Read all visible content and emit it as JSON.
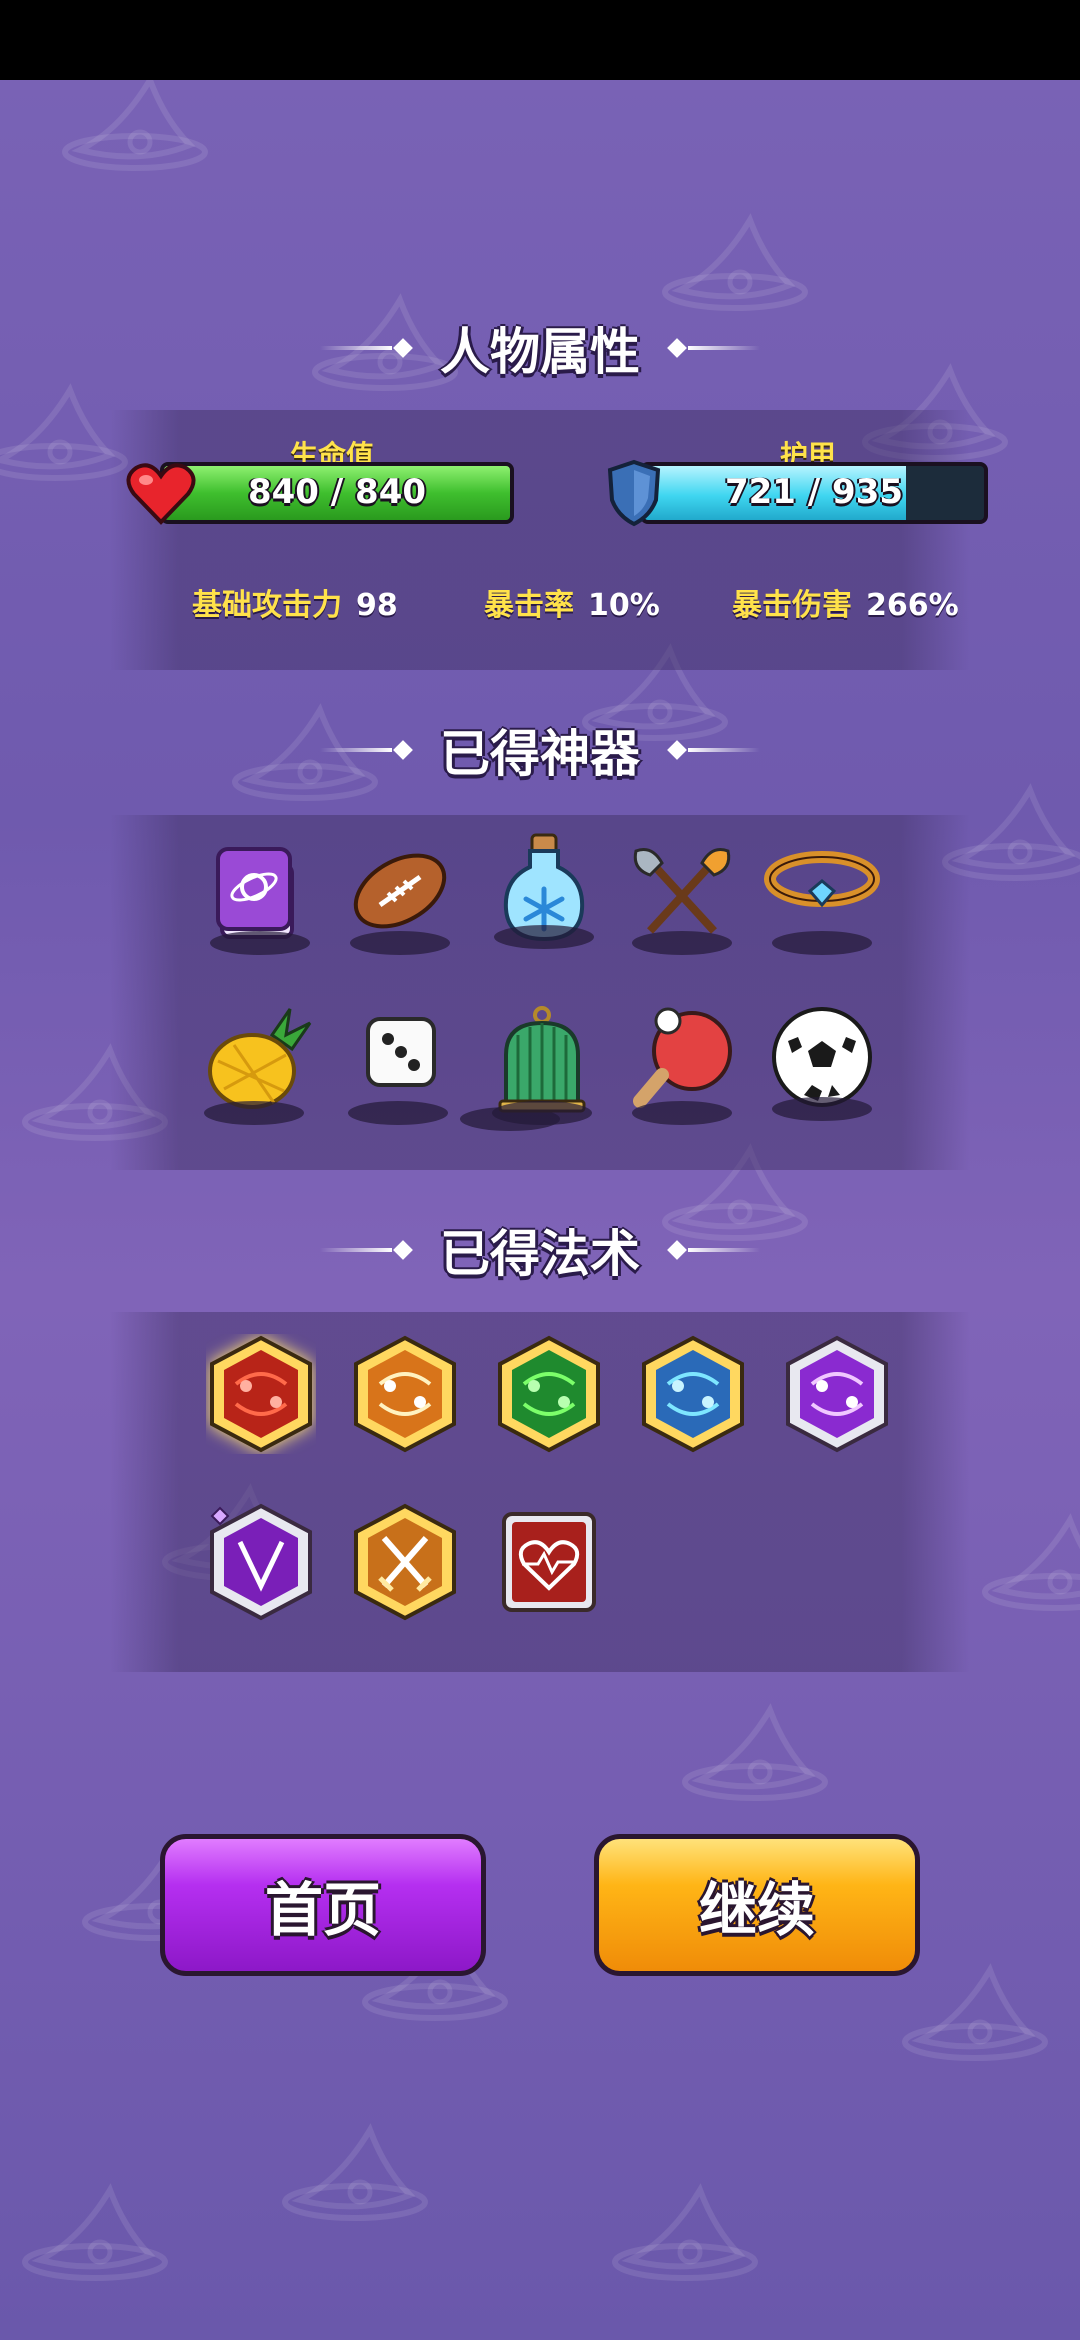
{
  "sections": {
    "attributes_title": "人物属性",
    "artifacts_title": "已得神器",
    "spells_title": "已得法术"
  },
  "hp": {
    "label": "生命值",
    "text": "840 / 840",
    "current": 840,
    "max": 840
  },
  "armor": {
    "label": "护甲",
    "text": "721 / 935",
    "current": 721,
    "max": 935
  },
  "stats": [
    {
      "key": "基础攻击力",
      "value": "98"
    },
    {
      "key": "暴击率",
      "value": "10%"
    },
    {
      "key": "暴击伤害",
      "value": "266%"
    }
  ],
  "artifacts": [
    {
      "icon": "purple-book-icon"
    },
    {
      "icon": "football-icon"
    },
    {
      "icon": "snowflake-potion-icon"
    },
    {
      "icon": "crossed-axes-icon"
    },
    {
      "icon": "gem-ring-icon"
    },
    {
      "icon": "pineapple-icon"
    },
    {
      "icon": "dice-icon"
    },
    {
      "icon": "birdcage-icon"
    },
    {
      "icon": "ping-pong-paddle-icon"
    },
    {
      "icon": "soccer-ball-icon"
    }
  ],
  "spells": [
    {
      "icon": "red-orbit-spell-icon"
    },
    {
      "icon": "orange-orbit-spell-icon"
    },
    {
      "icon": "green-orbit-spell-icon"
    },
    {
      "icon": "blue-orbit-spell-icon"
    },
    {
      "icon": "purple-orbit-spell-icon"
    },
    {
      "icon": "purple-v-spell-icon"
    },
    {
      "icon": "crossed-swords-spell-icon"
    },
    {
      "icon": "heartbeat-spell-icon"
    }
  ],
  "buttons": {
    "home": "首页",
    "continue": "继续"
  },
  "colors": {
    "hp": "#3fbf2e",
    "armor": "#3fd6f0",
    "home_button": "#b52ff0",
    "continue_button": "#ffb516"
  }
}
